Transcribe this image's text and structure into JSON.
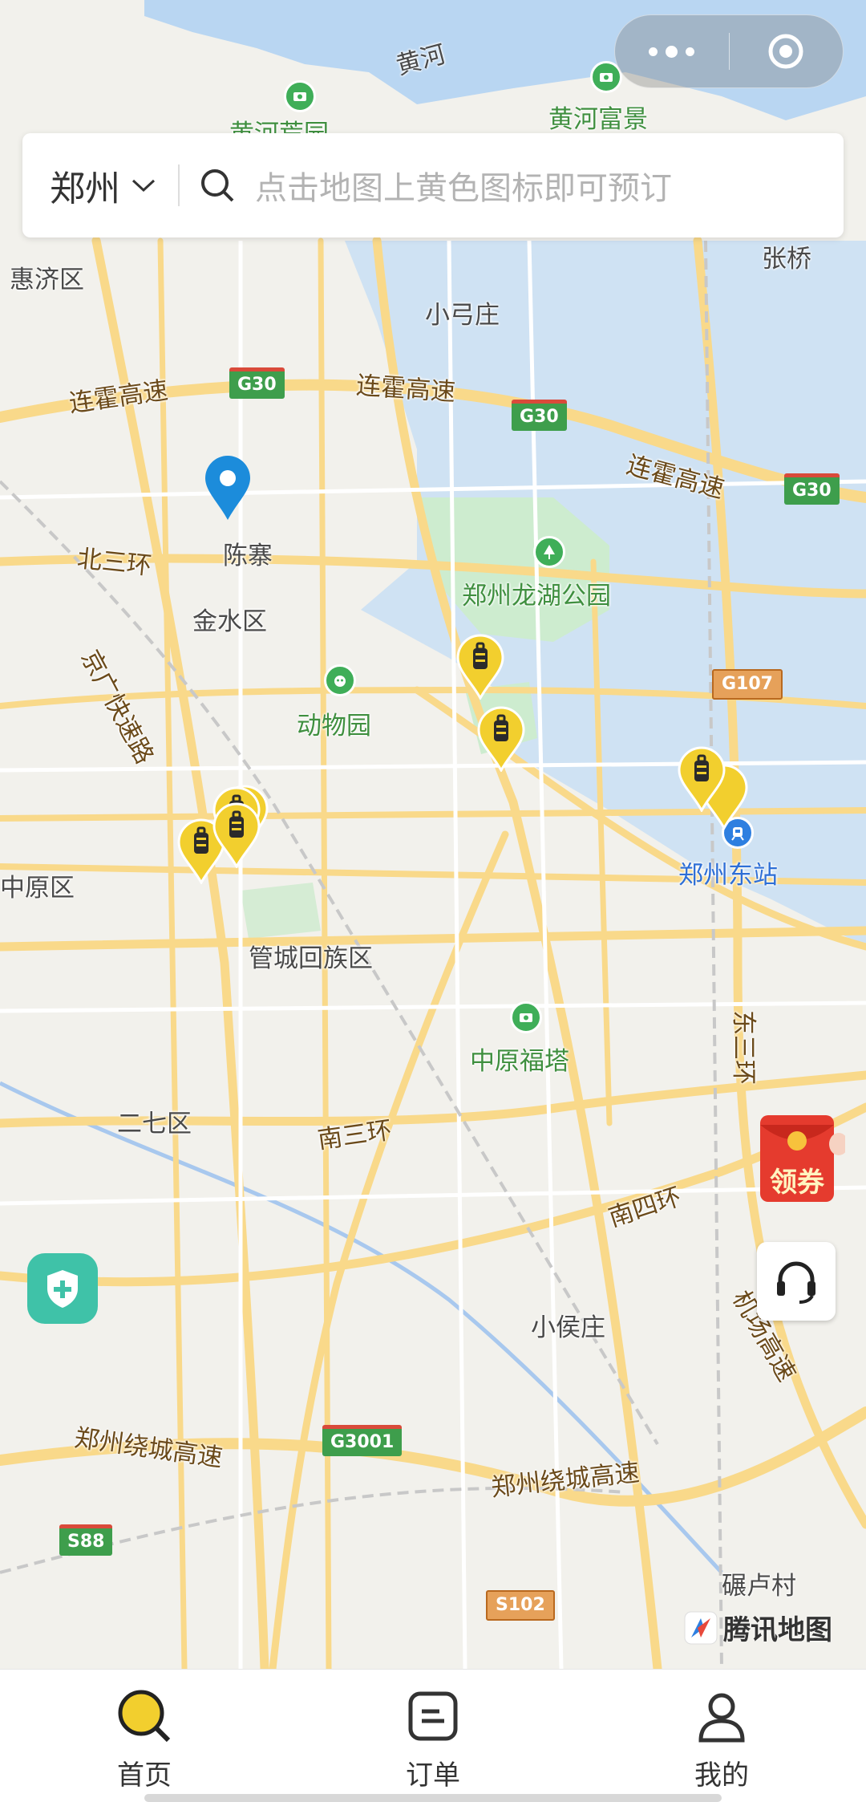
{
  "header": {
    "city": "郑州",
    "search_placeholder": "点击地图上黄色图标即可预订"
  },
  "map": {
    "labels": {
      "huanghe": "黄河",
      "huanghe_fujing": "黄河富景",
      "huanghe_fujing2": "黄河荒园",
      "huiji": "惠济区",
      "zhangqiao": "张桥",
      "xiaogongzhuang": "小弓庄",
      "lianhuo1": "连霍高速",
      "lianhuo2": "连霍高速",
      "lianhuo3": "连霍高速",
      "chenzhai": "陈寨",
      "beisanhuan": "北三环",
      "longhu_park": "郑州龙湖公园",
      "jinshui": "金水区",
      "jingguang": "京广快速路",
      "zoo": "动物园",
      "zhongyuan_qu": "中原区",
      "dongzhan": "郑州东站",
      "guancheng": "管城回族区",
      "dongsanhuan": "东三环",
      "futa": "中原福塔",
      "erqi": "二七区",
      "nansanhuan": "南三环",
      "nansihuan": "南四环",
      "xiaohouzhuang": "小侯庄",
      "jichang": "机场高速",
      "raocheng1": "郑州绕城高速",
      "raocheng2": "郑州绕城高速",
      "nianluhu": "碾卢村"
    },
    "shields": {
      "g30a": "G30",
      "g30b": "G30",
      "g30c": "G30",
      "g107": "G107",
      "g3001": "G3001",
      "s88": "S88",
      "s102": "S102"
    },
    "brand": "腾讯地图",
    "coupon_label": "领券",
    "pin_color": "#f2cf2e"
  },
  "tabs": [
    {
      "label": "首页",
      "icon": "search-icon",
      "active": true
    },
    {
      "label": "订单",
      "icon": "order-icon",
      "active": false
    },
    {
      "label": "我的",
      "icon": "user-icon",
      "active": false
    }
  ],
  "colors": {
    "water": "#b9d6f2",
    "road": "#f9d98a",
    "park": "#cdeccf",
    "accent": "#f2cf2e"
  }
}
